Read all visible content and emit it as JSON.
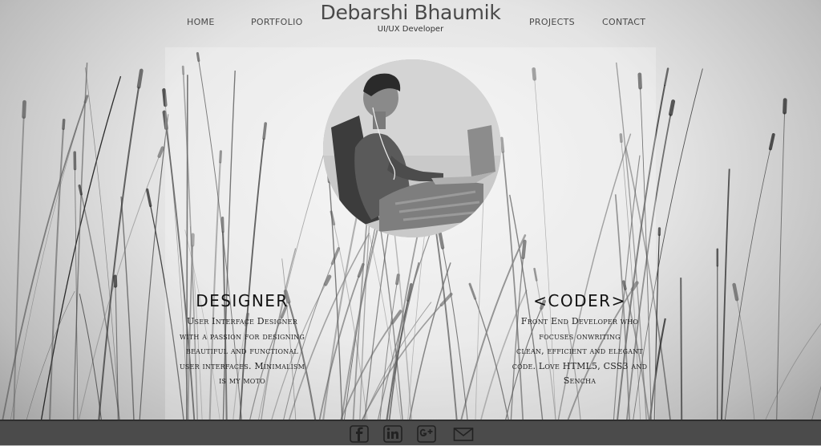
{
  "nav": {
    "home": "HOME",
    "portfolio": "PORTFOLIO",
    "projects": "PROJECTS",
    "contact": "CONTACT"
  },
  "brand": {
    "name": "Debarshi Bhaumik",
    "subtitle": "UI/UX Developer"
  },
  "designer": {
    "title": "DESIGNER",
    "lines": [
      "User Interface Designer",
      "with a passion for designing",
      "beautiful and functional",
      "user interfaces. Minimalism",
      "is my moto"
    ]
  },
  "coder": {
    "title": "<CODER>",
    "lines": [
      "Front End Developer who",
      "focuses onwriting",
      "clean, efficient and elegant",
      "code. Love HTML5, CSS3 and",
      "Sencha"
    ]
  },
  "footer": {
    "icons": [
      "facebook-icon",
      "linkedin-icon",
      "google-plus-icon",
      "mail-icon"
    ]
  },
  "colors": {
    "footer_bg": "#4b4b4b",
    "text_dark": "#4a4a4a"
  }
}
